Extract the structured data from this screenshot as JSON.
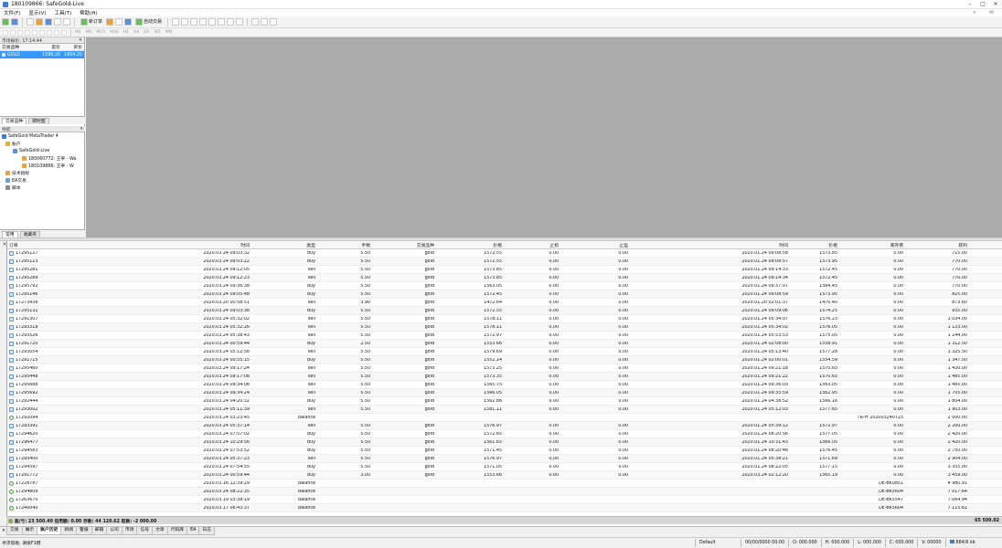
{
  "window": {
    "title": "180109866: SafeGold-Live",
    "minimize": "–",
    "maximize": "□",
    "close": "✕"
  },
  "menu": [
    "文件(F)",
    "显示(V)",
    "工具(T)",
    "帮助(H)"
  ],
  "toolbar": {
    "new_order": "新订单",
    "auto_trading": "自动交易"
  },
  "toolbar2": [
    "M1",
    "M5",
    "M15",
    "M30",
    "H1",
    "H4",
    "D1",
    "W1",
    "MN"
  ],
  "market_watch": {
    "header": "市场报价: 17:14:44",
    "columns": [
      "交易品种",
      "卖价",
      "买价"
    ],
    "rows": [
      {
        "symbol": "GOLD",
        "bid": "1599.20",
        "ask": "1604.20"
      }
    ],
    "tabs": [
      "交易品种",
      "即时图"
    ]
  },
  "navigator": {
    "header": "导航",
    "items": [
      {
        "label": "SafeGold MetaTrader 4",
        "indent": 0,
        "icon": "app-icon"
      },
      {
        "label": "账户",
        "indent": 1,
        "icon": "accounts-icon"
      },
      {
        "label": "SafeGold-Live",
        "indent": 2,
        "icon": "server-icon"
      },
      {
        "label": "180060772: 王寧 - Wa",
        "indent": 3,
        "icon": "user-icon"
      },
      {
        "label": "180109866: 王寧 - W",
        "indent": 3,
        "icon": "user-icon"
      },
      {
        "label": "技术指标",
        "indent": 1,
        "icon": "indicators-icon"
      },
      {
        "label": "EA交易",
        "indent": 1,
        "icon": "expert-icon"
      },
      {
        "label": "脚本",
        "indent": 1,
        "icon": "scripts-icon"
      }
    ],
    "tabs": [
      "常用",
      "收藏夹"
    ]
  },
  "terminal": {
    "columns": [
      "订单",
      "时间",
      "类型",
      "手数",
      "交易品种",
      "价格",
      "止损",
      "止盈",
      "时间",
      "价格",
      "库存费",
      "获利"
    ],
    "rows": [
      [
        "17295127",
        "2020.03.24 09:03:32",
        "buy",
        "5.50",
        "gold",
        "1572.55",
        "0.00",
        "0.00",
        "2020.01.24 09:08:58",
        "1573.85",
        "0.00",
        "715.00"
      ],
      [
        "17295113",
        "2020.03.24 09:03:22",
        "buy",
        "5.50",
        "gold",
        "1572.55",
        "0.00",
        "0.00",
        "2020.01.24 09:08:57",
        "1573.95",
        "0.00",
        "770.00"
      ],
      [
        "17295281",
        "2020.03.24 09:12:05",
        "sell",
        "5.50",
        "gold",
        "1573.85",
        "0.00",
        "0.00",
        "2020.01.24 09:14:33",
        "1572.45",
        "0.00",
        "770.00"
      ],
      [
        "17295289",
        "2020.03.24 09:12:23",
        "sell",
        "5.50",
        "gold",
        "1573.85",
        "0.00",
        "0.00",
        "2020.01.24 09:14:34",
        "1572.45",
        "0.00",
        "770.00"
      ],
      [
        "17295792",
        "2020.03.24 09:36:38",
        "buy",
        "5.50",
        "gold",
        "1563.05",
        "0.00",
        "0.00",
        "2020.01.24 09:37:07",
        "1564.45",
        "0.00",
        "770.00"
      ],
      [
        "17295146",
        "2020.03.24 09:05:48",
        "buy",
        "5.50",
        "gold",
        "1572.45",
        "0.00",
        "0.00",
        "2020.01.24 09:08:59",
        "1573.95",
        "0.00",
        "825.00"
      ],
      [
        "17273438",
        "2020.03.20 00:58:51",
        "sell",
        "3.90",
        "gold",
        "1472.64",
        "0.00",
        "0.00",
        "2020.01.20 02:01:37",
        "1470.40",
        "0.00",
        "873.60"
      ],
      [
        "17295131",
        "2020.03.24 09:03:38",
        "buy",
        "5.50",
        "gold",
        "1572.55",
        "0.00",
        "0.00",
        "2020.01.24 09:09:06",
        "1574.25",
        "0.00",
        "935.00"
      ],
      [
        "17291307",
        "2020.03.24 05:32:02",
        "sell",
        "5.50",
        "gold",
        "1578.11",
        "0.00",
        "0.00",
        "2020.01.24 05:34:07",
        "1576.23",
        "0.00",
        "1 034.00"
      ],
      [
        "17293318",
        "2020.03.24 05:32:26",
        "sell",
        "5.50",
        "gold",
        "1578.11",
        "0.00",
        "0.00",
        "2020.01.24 05:34:02",
        "1576.05",
        "0.00",
        "1 133.00"
      ],
      [
        "17293526",
        "2020.03.24 05:38:43",
        "sell",
        "5.50",
        "gold",
        "1572.97",
        "0.00",
        "0.00",
        "2020.01.24 05:53:53",
        "1575.05",
        "0.00",
        "1 144.00"
      ],
      [
        "17291720",
        "2020.03.24 00:59:44",
        "buy",
        "2.50",
        "gold",
        "1553.66",
        "0.00",
        "0.00",
        "2020.01.24 02:08:00",
        "1558.91",
        "0.00",
        "1 312.50"
      ],
      [
        "17293054",
        "2020.03.24 05:12:58",
        "sell",
        "5.50",
        "gold",
        "1579.69",
        "0.00",
        "0.00",
        "2020.01.24 05:13:40",
        "1577.28",
        "0.00",
        "1 325.50"
      ],
      [
        "17291715",
        "2020.03.24 00:55:15",
        "buy",
        "5.50",
        "gold",
        "1552.14",
        "0.00",
        "0.00",
        "2020.01.24 02:00:01",
        "1554.59",
        "0.00",
        "1 347.50"
      ],
      [
        "17295460",
        "2020.03.24 09:17:24",
        "sell",
        "5.50",
        "gold",
        "1573.25",
        "0.00",
        "0.00",
        "2020.01.24 09:21:18",
        "1570.65",
        "0.00",
        "1 430.00"
      ],
      [
        "17295448",
        "2020.03.24 09:17:08",
        "sell",
        "5.50",
        "gold",
        "1573.35",
        "0.00",
        "0.00",
        "2020.01.24 09:21:22",
        "1570.65",
        "0.00",
        "1 485.00"
      ],
      [
        "17295688",
        "2020.03.24 09:34:08",
        "sell",
        "5.50",
        "gold",
        "1565.75",
        "0.00",
        "0.00",
        "2020.01.24 09:36:03",
        "1563.05",
        "0.00",
        "1 485.00"
      ],
      [
        "17295692",
        "2020.03.24 09:34:24",
        "sell",
        "5.50",
        "gold",
        "1566.05",
        "0.00",
        "0.00",
        "2020.01.24 09:35:59",
        "1562.95",
        "0.00",
        "1 705.00"
      ],
      [
        "17292444",
        "2020.03.24 04:20:32",
        "buy",
        "5.50",
        "gold",
        "1562.88",
        "0.00",
        "0.00",
        "2020.01.24 04:38:52",
        "1566.16",
        "0.00",
        "1 804.00"
      ],
      [
        "17293002",
        "2020.03.24 05:11:39",
        "sell",
        "5.50",
        "gold",
        "1581.11",
        "0.00",
        "0.00",
        "2020.01.24 05:12:03",
        "1577.65",
        "0.00",
        "1 903.00"
      ],
      [
        "17292094",
        "2020.03.24 03:23:45",
        "balance",
        "",
        "",
        "",
        "",
        "",
        "",
        "",
        "TR-Fr 202003240723",
        "2 000.00"
      ],
      [
        "17293391",
        "2020.03.24 05:37:14",
        "sell",
        "5.50",
        "gold",
        "1576.97",
        "0.00",
        "0.00",
        "2020.01.24 05:39:12",
        "1572.97",
        "0.00",
        "2 200.00"
      ],
      [
        "17294620",
        "2020.03.24 07:57:02",
        "buy",
        "5.50",
        "gold",
        "1572.65",
        "0.00",
        "0.00",
        "2020.01.24 08:20:56",
        "1577.05",
        "0.00",
        "2 420.00"
      ],
      [
        "17296477",
        "2020.03.24 10:29:56",
        "buy",
        "5.50",
        "gold",
        "1561.65",
        "0.00",
        "0.00",
        "2020.01.24 10:31:43",
        "1566.05",
        "0.00",
        "2 420.00"
      ],
      [
        "17294583",
        "2020.03.24 07:53:52",
        "buy",
        "5.50",
        "gold",
        "1571.45",
        "0.00",
        "0.00",
        "2020.01.24 08:20:48",
        "1576.45",
        "0.00",
        "2 750.00"
      ],
      [
        "17293400",
        "2020.03.24 05:37:23",
        "sell",
        "5.50",
        "gold",
        "1576.97",
        "0.00",
        "0.00",
        "2020.01.24 05:38:21",
        "1571.69",
        "0.00",
        "2 904.00"
      ],
      [
        "17294597",
        "2020.03.24 07:54:55",
        "buy",
        "5.50",
        "gold",
        "1571.05",
        "0.00",
        "0.00",
        "2020.01.24 08:22:05",
        "1577.15",
        "0.00",
        "3 355.00"
      ],
      [
        "17291772",
        "2020.03.24 00:59:44",
        "buy",
        "3.00",
        "gold",
        "1553.66",
        "0.00",
        "0.00",
        "2020.03.24 02:12:20",
        "1565.19",
        "0.00",
        "3 459.00"
      ],
      [
        "17228787",
        "2020.03.16 12:39:29",
        "balance",
        "",
        "",
        "",
        "",
        "",
        "",
        "",
        "DE-BK0851",
        "4 980.91"
      ],
      [
        "17294809",
        "2020.03.24 08:22:35",
        "balance",
        "",
        "",
        "",
        "",
        "",
        "",
        "",
        "DE-BK5604",
        "7 017.64"
      ],
      [
        "17263670",
        "2020.03.19 03:38:19",
        "balance",
        "",
        "",
        "",
        "",
        "",
        "",
        "",
        "DE-BK5547",
        "7 064.94"
      ],
      [
        "17240040",
        "2020.03.17 06:43:37",
        "balance",
        "",
        "",
        "",
        "",
        "",
        "",
        "",
        "DE-BK5604",
        "7 115.61"
      ]
    ],
    "summary_label": "盈/亏: 23 500.40  信用额: 0.00  存款: 44 120.62  取款: -2 000.00",
    "summary_value": "65 509.02"
  },
  "bottom_tabs": [
    "交易",
    "展示",
    "账户历史",
    "新闻",
    "警报",
    "邮箱",
    "公司",
    "市场",
    "信号",
    "文章",
    "代码库",
    "EA",
    "日志"
  ],
  "active_tab_index": 2,
  "status": {
    "help": "寻求帮助, 请按F1键",
    "profile": "Default",
    "time": "00/00/0000 00:00",
    "open": "O: 000.000",
    "high": "H: 000.000",
    "low": "L: 000.000",
    "close": "C: 000.000",
    "volume": "V: 00000",
    "traffic": "884/6 kb"
  }
}
